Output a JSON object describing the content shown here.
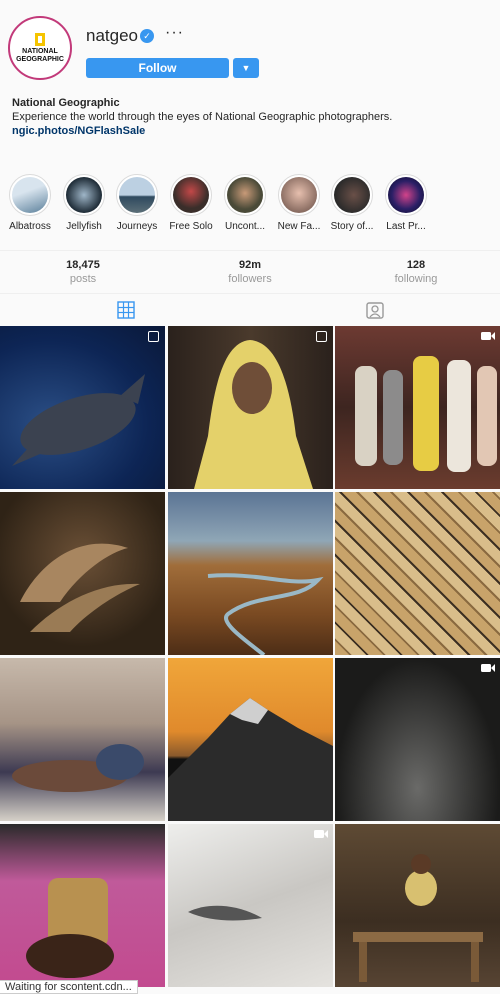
{
  "profile": {
    "username": "natgeo",
    "logo_text": "NATIONAL GEOGRAPHIC",
    "follow_label": "Follow",
    "display_name": "National Geographic",
    "bio": "Experience the world through the eyes of National Geographic photographers.",
    "link": "ngic.photos/NGFlashSale"
  },
  "highlights": [
    {
      "label": "Albatross"
    },
    {
      "label": "Jellyfish"
    },
    {
      "label": "Journeys"
    },
    {
      "label": "Free Solo"
    },
    {
      "label": "Uncont..."
    },
    {
      "label": "New Fa..."
    },
    {
      "label": "Story of..."
    },
    {
      "label": "Last Pr..."
    }
  ],
  "stats": {
    "posts": {
      "value": "18,475",
      "label": "posts"
    },
    "followers": {
      "value": "92m",
      "label": "followers"
    },
    "following": {
      "value": "128",
      "label": "following"
    }
  },
  "grid": [
    {
      "subject": "whale shark underwater",
      "badge": "multiple"
    },
    {
      "subject": "woman in yellow headscarf",
      "badge": "multiple"
    },
    {
      "subject": "group of people in market",
      "badge": "video"
    },
    {
      "subject": "two snakes close-up",
      "badge": ""
    },
    {
      "subject": "river valley aerial",
      "badge": ""
    },
    {
      "subject": "aerial view of city blocks",
      "badge": ""
    },
    {
      "subject": "mother and child sleeping",
      "badge": ""
    },
    {
      "subject": "mountain peak at sunset",
      "badge": ""
    },
    {
      "subject": "rocky terrain at night",
      "badge": "video"
    },
    {
      "subject": "hands holding objects",
      "badge": ""
    },
    {
      "subject": "close-up of horse eye",
      "badge": "video"
    },
    {
      "subject": "child sitting on bench",
      "badge": ""
    }
  ],
  "status_text": "Waiting for scontent.cdn..."
}
